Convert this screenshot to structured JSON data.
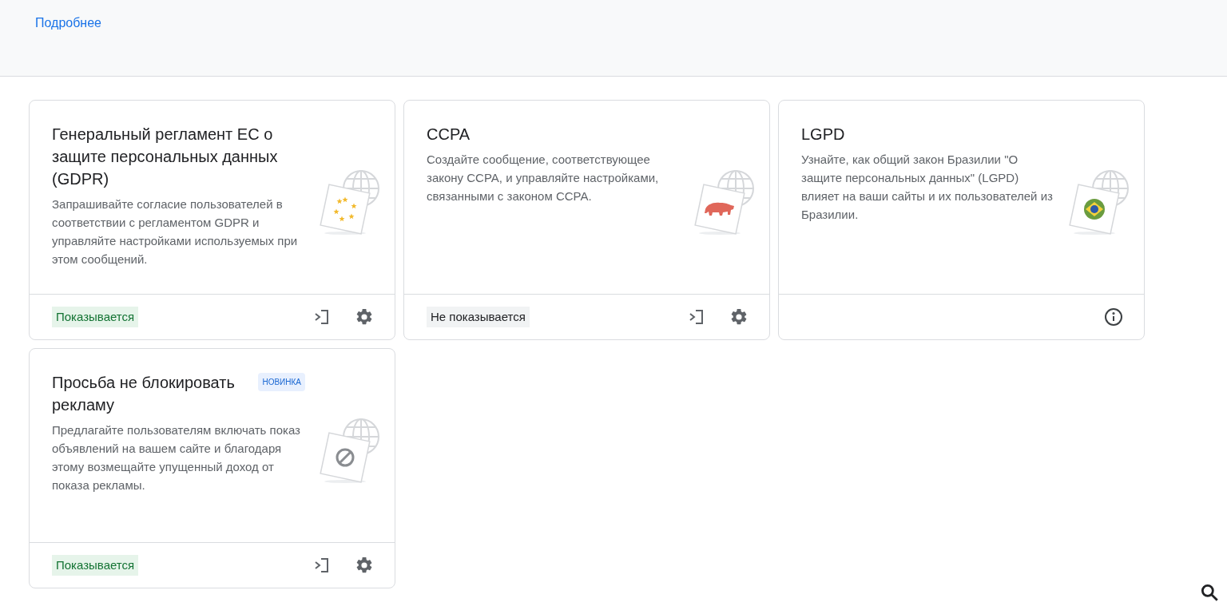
{
  "header": {
    "link": "Подробнее"
  },
  "cards": [
    {
      "title": "Генеральный регламент ЕС о защите персональных данных (GDPR)",
      "description": "Запрашивайте согласие пользователей в соответствии с регламентом GDPR и управляйте настройками используемых при этом сообщений.",
      "illustration": {
        "kind": "eu"
      },
      "status": {
        "text": "Показывается",
        "shown": true
      },
      "actions": [
        {
          "kind": "preview"
        },
        {
          "kind": "settings"
        }
      ]
    },
    {
      "title": "CCPA",
      "description": "Создайте сообщение, соответствующее закону CCPA, и управляйте настройками, связанными с законом CCPA.",
      "illustration": {
        "kind": "bear"
      },
      "status": {
        "text": "Не показывается",
        "shown": false
      },
      "actions": [
        {
          "kind": "preview"
        },
        {
          "kind": "settings"
        }
      ]
    },
    {
      "title": "LGPD",
      "description": "Узнайте, как общий закон Бразилии \"О защите персональных данных\" (LGPD) влияет на ваши сайты и их пользователей из Бразилии.",
      "illustration": {
        "kind": "brazil"
      },
      "actions": [
        {
          "kind": "info"
        }
      ]
    },
    {
      "title": "Просьба не блокировать рекламу",
      "badge": "НОВИНКА",
      "description": "Предлагайте пользователям включать показ объявлений на вашем сайте и благодаря этому возмещайте упущенный доход от показа рекламы.",
      "illustration": {
        "kind": "block"
      },
      "status": {
        "text": "Показывается",
        "shown": true
      },
      "actions": [
        {
          "kind": "preview"
        },
        {
          "kind": "settings"
        }
      ]
    }
  ]
}
